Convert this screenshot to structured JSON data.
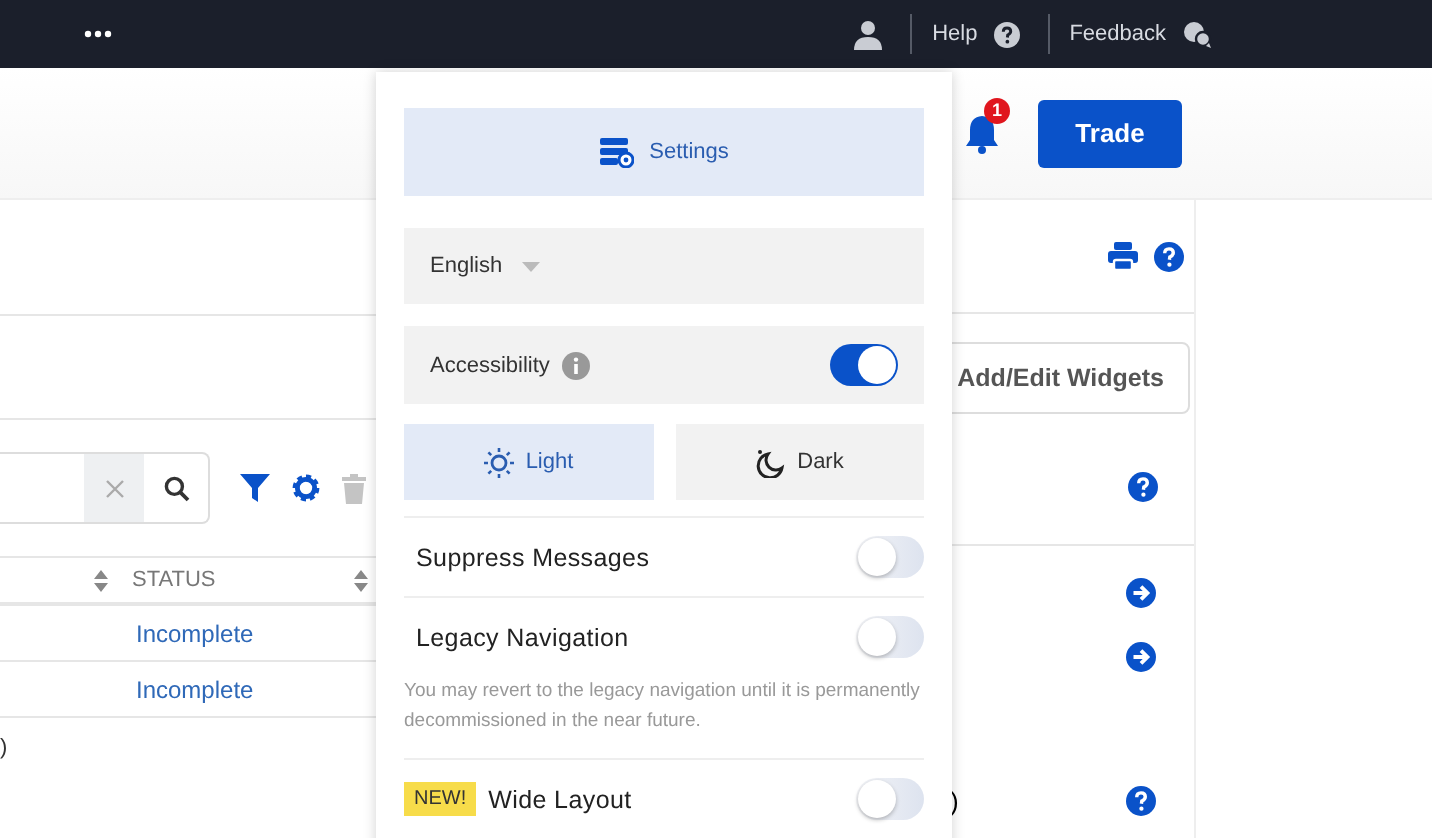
{
  "top_bar": {
    "links": [
      {
        "label": "Help"
      },
      {
        "label": "Feedback"
      }
    ]
  },
  "header": {
    "notification_count": "1",
    "trade_button": "Trade"
  },
  "page": {
    "widgets_button": "Add/Edit Widgets",
    "table": {
      "columns": [
        "STATUS"
      ],
      "rows": [
        {
          "status": "Incomplete"
        },
        {
          "status": "Incomplete"
        }
      ]
    },
    "left_fragment": ")",
    "right_fragment": ")"
  },
  "settings_menu": {
    "settings_button": "Settings",
    "language": "English",
    "accessibility": {
      "label": "Accessibility",
      "on": true
    },
    "themes": [
      {
        "label": "Light",
        "kind": "light",
        "selected": true
      },
      {
        "label": "Dark",
        "kind": "dark",
        "selected": false
      }
    ],
    "toggles": [
      {
        "label": "Suppress Messages",
        "on": false
      },
      {
        "label": "Legacy Navigation",
        "on": false,
        "note": "You may revert to the legacy navigation until it is permanently decommissioned in the near future."
      },
      {
        "label": "Wide Layout",
        "on": false,
        "badge": "NEW!"
      }
    ]
  }
}
